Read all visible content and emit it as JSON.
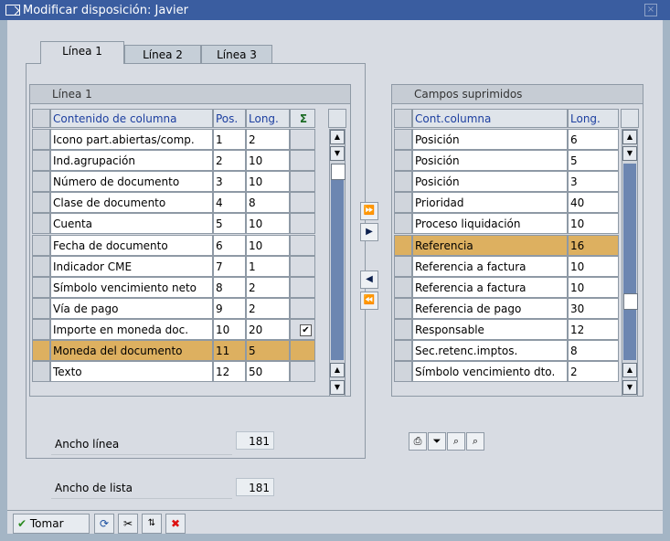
{
  "window": {
    "title": "Modificar disposición: Javier"
  },
  "tabs": [
    "Línea 1",
    "Línea 2",
    "Línea 3"
  ],
  "left": {
    "group_title": "Línea 1",
    "headers": {
      "content": "Contenido de columna",
      "pos": "Pos.",
      "len": "Long.",
      "sum": "Σ"
    },
    "rows": [
      {
        "name": "Icono part.abiertas/comp.",
        "pos": "1",
        "len": "2",
        "sum": ""
      },
      {
        "name": "Ind.agrupación",
        "pos": "2",
        "len": "10",
        "sum": ""
      },
      {
        "name": "Número de documento",
        "pos": "3",
        "len": "10",
        "sum": ""
      },
      {
        "name": "Clase de documento",
        "pos": "4",
        "len": "8",
        "sum": ""
      },
      {
        "name": "Cuenta",
        "pos": "5",
        "len": "10",
        "sum": ""
      },
      {
        "name": "Fecha de documento",
        "pos": "6",
        "len": "10",
        "sum": ""
      },
      {
        "name": "Indicador CME",
        "pos": "7",
        "len": "1",
        "sum": ""
      },
      {
        "name": "Símbolo vencimiento neto",
        "pos": "8",
        "len": "2",
        "sum": ""
      },
      {
        "name": "Vía de pago",
        "pos": "9",
        "len": "2",
        "sum": ""
      },
      {
        "name": "Importe en moneda doc.",
        "pos": "10",
        "len": "20",
        "sum": "✔"
      },
      {
        "name": "Moneda del documento",
        "pos": "11",
        "len": "5",
        "sum": ""
      },
      {
        "name": "Texto",
        "pos": "12",
        "len": "50",
        "sum": ""
      }
    ],
    "selected_row": 10
  },
  "right": {
    "group_title": "Campos suprimidos",
    "headers": {
      "content": "Cont.columna",
      "len": "Long."
    },
    "rows": [
      {
        "name": "Posición",
        "len": "6"
      },
      {
        "name": "Posición",
        "len": "5"
      },
      {
        "name": "Posición",
        "len": "3"
      },
      {
        "name": "Prioridad",
        "len": "40"
      },
      {
        "name": "Proceso liquidación",
        "len": "10"
      },
      {
        "name": "Referencia",
        "len": "16"
      },
      {
        "name": "Referencia a factura",
        "len": "10"
      },
      {
        "name": "Referencia a factura",
        "len": "10"
      },
      {
        "name": "Referencia de pago",
        "len": "30"
      },
      {
        "name": "Responsable",
        "len": "12"
      },
      {
        "name": "Sec.retenc.imptos.",
        "len": "8"
      },
      {
        "name": "Símbolo vencimiento dto.",
        "len": "2"
      }
    ],
    "selected_row": 5
  },
  "move_buttons": [
    "⏩",
    "▶",
    "◀",
    "⏪"
  ],
  "ancho_linea": {
    "label": "Ancho línea",
    "value": "181"
  },
  "ancho_lista": {
    "label": "Ancho de lista",
    "value": "181"
  },
  "toolbar_icons": [
    "print-icon",
    "filter-icon",
    "find-icon",
    "find-next-icon"
  ],
  "bottom": {
    "tomar": "Tomar"
  }
}
